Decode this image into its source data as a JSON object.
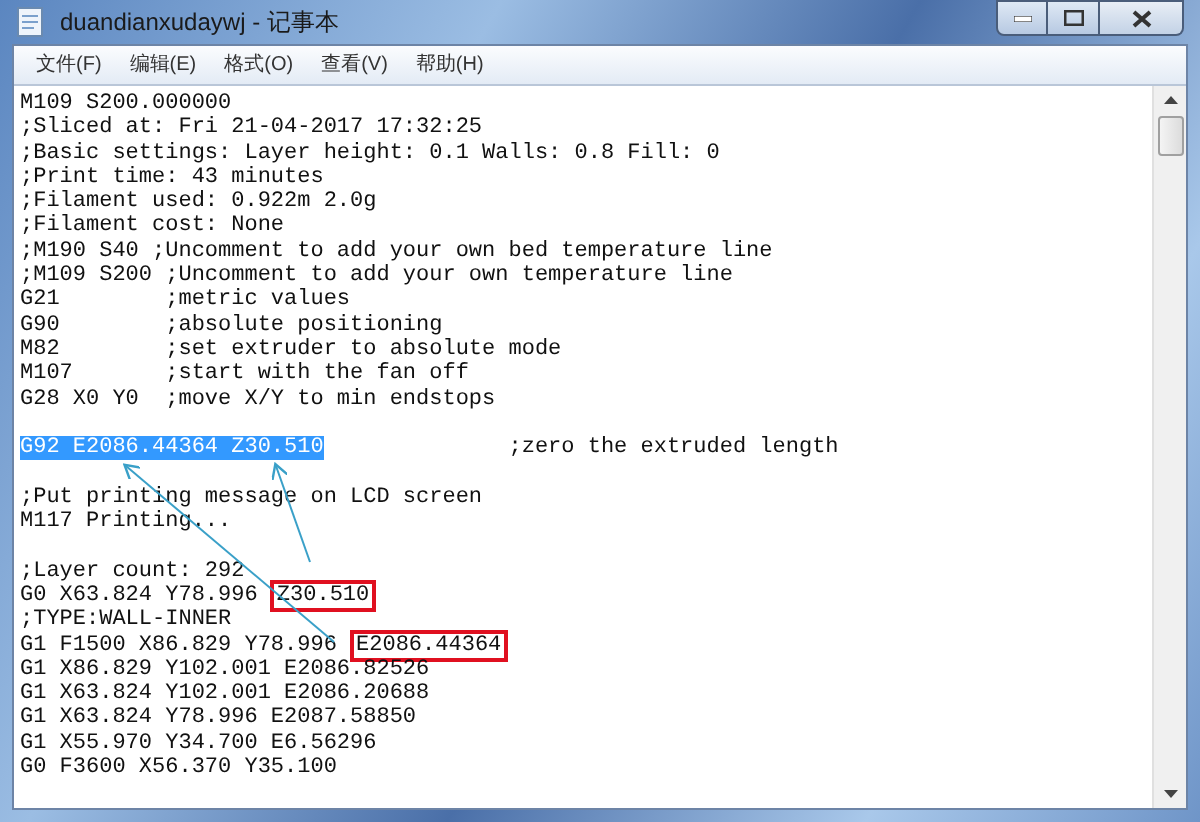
{
  "window": {
    "title": "duandianxudaywj - 记事本"
  },
  "menu": [
    {
      "label": "文件(F)"
    },
    {
      "label": "编辑(E)"
    },
    {
      "label": "格式(O)"
    },
    {
      "label": "查看(V)"
    },
    {
      "label": "帮助(H)"
    }
  ],
  "lines": [
    [
      {
        "kind": "plain",
        "text": "M109 S200.000000"
      }
    ],
    [
      {
        "kind": "plain",
        "text": ";Sliced at: Fri 21-04-2017 17:32:25"
      }
    ],
    [
      {
        "kind": "plain",
        "text": ";Basic settings: Layer height: 0.1 Walls: 0.8 Fill: 0"
      }
    ],
    [
      {
        "kind": "plain",
        "text": ";Print time: 43 minutes"
      }
    ],
    [
      {
        "kind": "plain",
        "text": ";Filament used: 0.922m 2.0g"
      }
    ],
    [
      {
        "kind": "plain",
        "text": ";Filament cost: None"
      }
    ],
    [
      {
        "kind": "plain",
        "text": ";M190 S40 ;Uncomment to add your own bed temperature line"
      }
    ],
    [
      {
        "kind": "plain",
        "text": ";M109 S200 ;Uncomment to add your own temperature line"
      }
    ],
    [
      {
        "kind": "plain",
        "text": "G21        ;metric values"
      }
    ],
    [
      {
        "kind": "plain",
        "text": "G90        ;absolute positioning"
      }
    ],
    [
      {
        "kind": "plain",
        "text": "M82        ;set extruder to absolute mode"
      }
    ],
    [
      {
        "kind": "plain",
        "text": "M107       ;start with the fan off"
      }
    ],
    [
      {
        "kind": "plain",
        "text": "G28 X0 Y0  ;move X/Y to min endstops"
      }
    ],
    [
      {
        "kind": "blank"
      }
    ],
    [
      {
        "kind": "selection",
        "text": "G92 E2086.44364 Z30.510"
      },
      {
        "kind": "plain",
        "text": "              ;zero the extruded length"
      }
    ],
    [
      {
        "kind": "blank"
      }
    ],
    [
      {
        "kind": "plain",
        "text": ";Put printing message on LCD screen"
      }
    ],
    [
      {
        "kind": "plain",
        "text": "M117 Printing..."
      }
    ],
    [
      {
        "kind": "blank"
      }
    ],
    [
      {
        "kind": "plain",
        "text": ";Layer count: 292"
      }
    ],
    [
      {
        "kind": "plain",
        "text": "G0 X63.824 Y78.996 "
      },
      {
        "kind": "boxed",
        "text": "Z30.510"
      }
    ],
    [
      {
        "kind": "plain",
        "text": ";TYPE:WALL-INNER"
      }
    ],
    [
      {
        "kind": "plain",
        "text": "G1 F1500 X86.829 Y78.996 "
      },
      {
        "kind": "boxed",
        "text": "E2086.44364"
      }
    ],
    [
      {
        "kind": "plain",
        "text": "G1 X86.829 Y102.001 E2086.82526"
      }
    ],
    [
      {
        "kind": "plain",
        "text": "G1 X63.824 Y102.001 E2086.20688"
      }
    ],
    [
      {
        "kind": "plain",
        "text": "G1 X63.824 Y78.996 E2087.58850"
      }
    ],
    [
      {
        "kind": "plain",
        "text": "G1 X55.970 Y34.700 E6.56296"
      }
    ],
    [
      {
        "kind": "plain",
        "text": "G0 F3600 X56.370 Y35.100"
      }
    ]
  ]
}
